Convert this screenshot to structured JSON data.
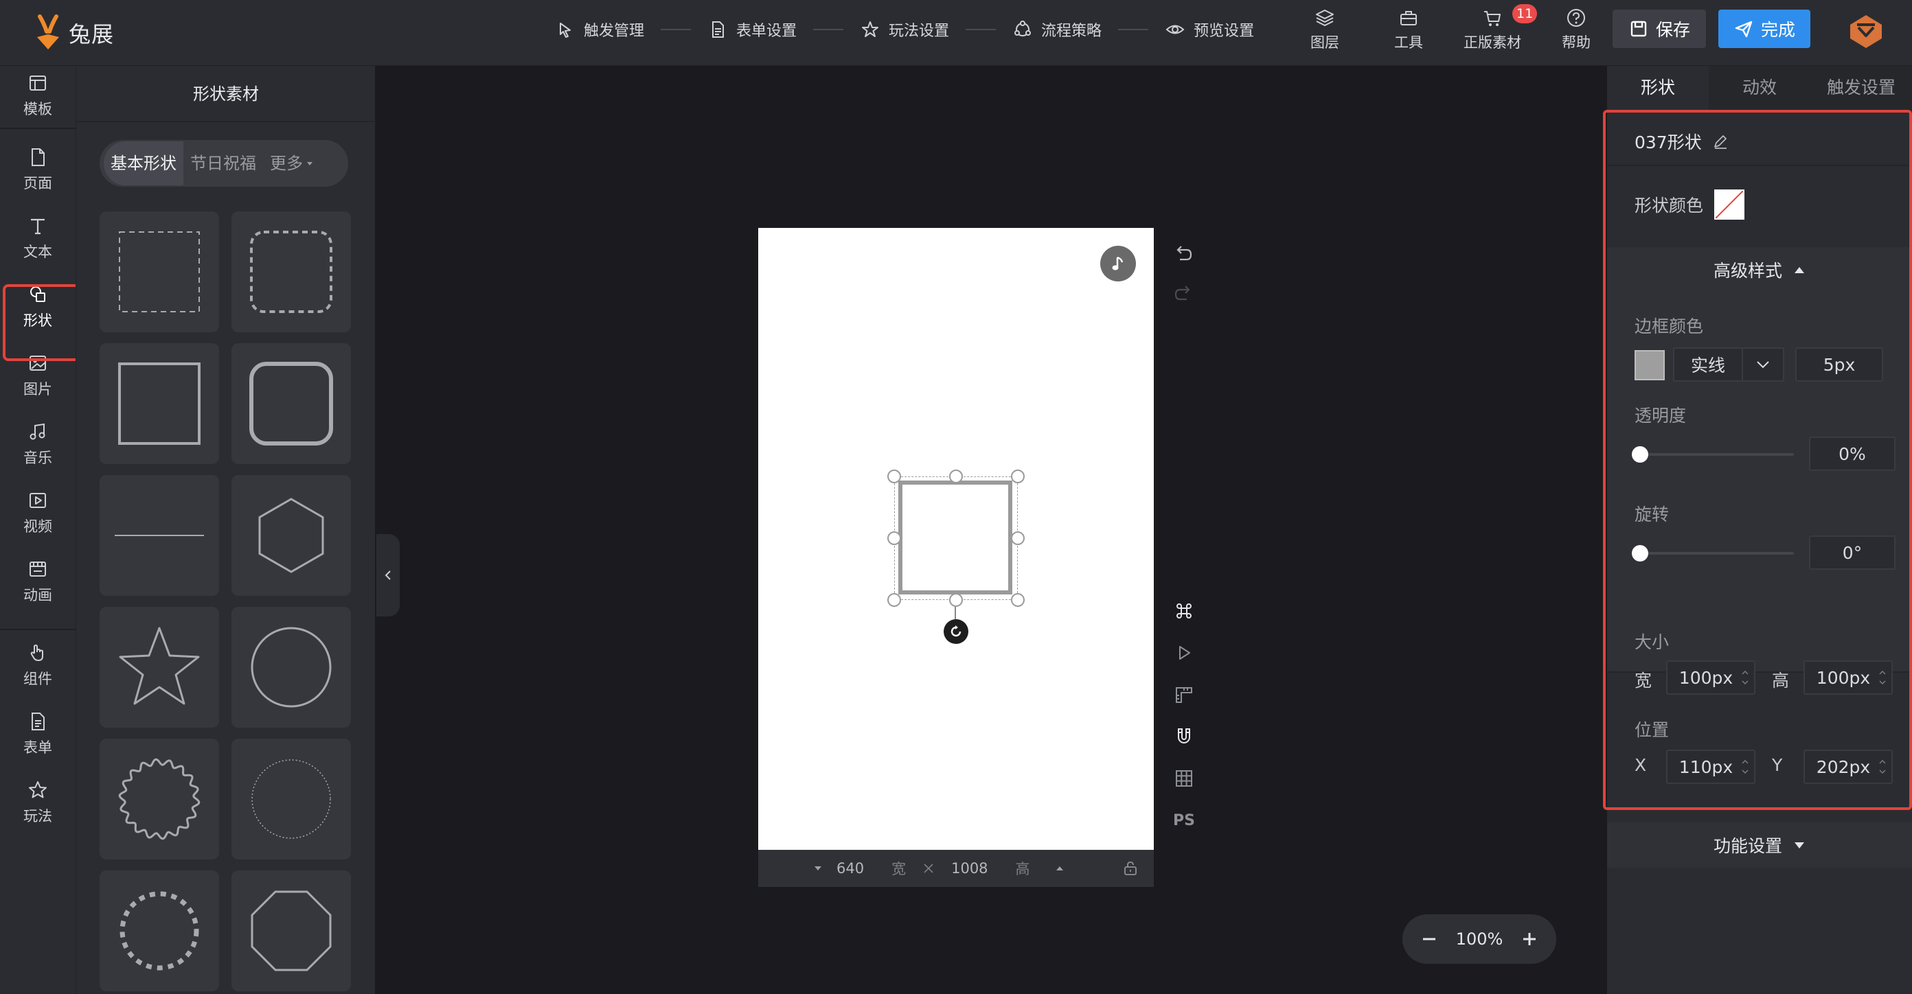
{
  "app": {
    "name": "兔展"
  },
  "steps": [
    {
      "label": "触发管理",
      "icon": "cursor-click-icon"
    },
    {
      "label": "表单设置",
      "icon": "document-icon"
    },
    {
      "label": "玩法设置",
      "icon": "star-icon"
    },
    {
      "label": "流程策略",
      "icon": "flow-icon"
    },
    {
      "label": "预览设置",
      "icon": "eye-icon"
    }
  ],
  "tools": [
    {
      "label": "图层",
      "icon": "layers-icon"
    },
    {
      "label": "工具",
      "icon": "toolbox-icon"
    },
    {
      "label": "正版素材",
      "icon": "cart-icon",
      "badge": "11"
    },
    {
      "label": "帮助",
      "icon": "help-icon"
    }
  ],
  "actions": {
    "save": "保存",
    "done": "完成"
  },
  "leftnav": [
    {
      "label": "模板",
      "icon": "template-icon"
    },
    {
      "label": "页面",
      "icon": "page-icon"
    },
    {
      "label": "文本",
      "icon": "text-icon"
    },
    {
      "label": "形状",
      "icon": "shape-icon",
      "active": true
    },
    {
      "label": "图片",
      "icon": "image-icon"
    },
    {
      "label": "音乐",
      "icon": "music-icon"
    },
    {
      "label": "视频",
      "icon": "video-icon"
    },
    {
      "label": "动画",
      "icon": "animation-icon"
    },
    {
      "label": "组件",
      "icon": "hand-icon"
    },
    {
      "label": "表单",
      "icon": "form-icon"
    },
    {
      "label": "玩法",
      "icon": "star-icon"
    }
  ],
  "material": {
    "title": "形状素材",
    "tabs": [
      "基本形状",
      "节日祝福",
      "更多"
    ],
    "shapes": [
      "dashed-square",
      "dashed-rounded-square",
      "square",
      "rounded-square",
      "line",
      "hexagon",
      "star",
      "circle",
      "wavy-circle",
      "dotted-circle",
      "dashed-thick-circle",
      "octagon"
    ]
  },
  "canvas": {
    "width": "640",
    "width_unit": "宽",
    "height": "1008",
    "height_unit": "高",
    "zoom": "100%"
  },
  "right": {
    "tabs": [
      "形状",
      "动效",
      "触发设置"
    ],
    "shape_name": "037形状",
    "shape_color_label": "形状颜色",
    "advanced_label": "高级样式",
    "border_color_label": "边框颜色",
    "border_style": "实线",
    "border_width": "5px",
    "opacity_label": "透明度",
    "opacity_value": "0%",
    "rotation_label": "旋转",
    "rotation_value": "0°",
    "size_label": "大小",
    "width_label": "宽",
    "width_value": "100px",
    "height_label": "高",
    "height_value": "100px",
    "position_label": "位置",
    "x_label": "X",
    "x_value": "110px",
    "y_label": "Y",
    "y_value": "202px",
    "function_label": "功能设置"
  },
  "colors": {
    "accent": "#2f8eed",
    "highlight": "#e2433b",
    "badge": "#ea4b4b",
    "border": "#9e9e9e"
  }
}
